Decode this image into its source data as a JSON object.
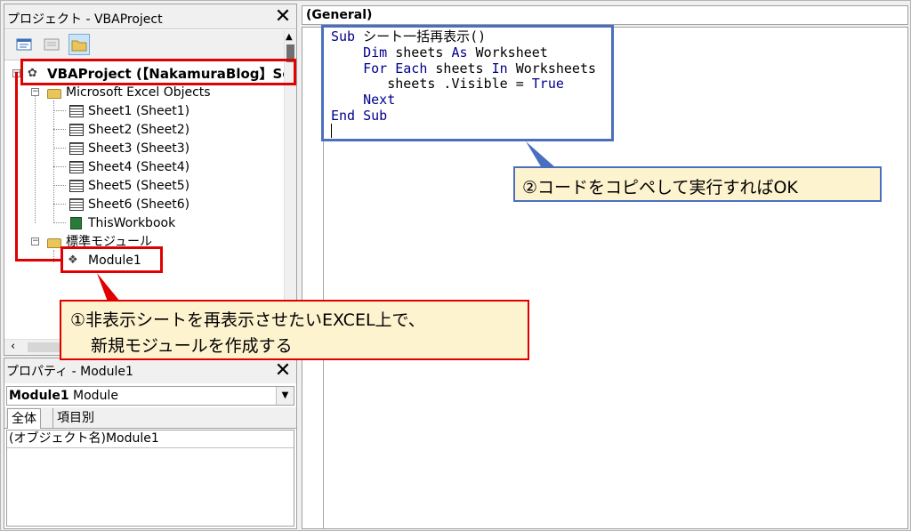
{
  "project_pane": {
    "title": "プロジェクト - VBAProject",
    "close_label": "✕",
    "tree": {
      "project": "VBAProject (【NakamuraBlog】Selen",
      "excel_objects_folder": "Microsoft Excel Objects",
      "sheets": [
        "Sheet1 (Sheet1)",
        "Sheet2 (Sheet2)",
        "Sheet3 (Sheet3)",
        "Sheet4 (Sheet4)",
        "Sheet5 (Sheet5)",
        "Sheet6 (Sheet6)"
      ],
      "workbook": "ThisWorkbook",
      "modules_folder": "標準モジュール",
      "module": "Module1"
    },
    "hscroll_left": "‹"
  },
  "properties_pane": {
    "title": "プロパティ - Module1",
    "close_label": "✕",
    "object_combo_name": "Module1",
    "object_combo_type": "Module",
    "tabs": [
      "全体",
      "項目別"
    ],
    "row_label": "(オブジェクト名)",
    "row_value": "Module1"
  },
  "code_window": {
    "object_combo": "(General)",
    "lines": [
      [
        {
          "k": "Sub"
        },
        {
          "t": " シート一括再表示()"
        }
      ],
      [
        {
          "t": "    "
        },
        {
          "k": "Dim"
        },
        {
          "t": " sheets "
        },
        {
          "k": "As"
        },
        {
          "t": " Worksheet"
        }
      ],
      [
        {
          "t": "    "
        },
        {
          "k": "For Each"
        },
        {
          "t": " sheets "
        },
        {
          "k": "In"
        },
        {
          "t": " Worksheets"
        }
      ],
      [
        {
          "t": "       sheets .Visible = "
        },
        {
          "k": "True"
        }
      ],
      [
        {
          "t": "    "
        },
        {
          "k": "Next"
        }
      ],
      [
        {
          "k": "End Sub"
        }
      ]
    ]
  },
  "annotations": {
    "callout_1_line1": "①非表示シートを再表示させたいEXCEL上で、",
    "callout_1_line2": "新規モジュールを作成する",
    "callout_2": "②コードをコピペして実行すればOK"
  },
  "colors": {
    "keyword": "#00008b",
    "red_annotation": "#e00000",
    "blue_annotation": "#4a6fc0",
    "callout_fill": "#fef3cf"
  }
}
